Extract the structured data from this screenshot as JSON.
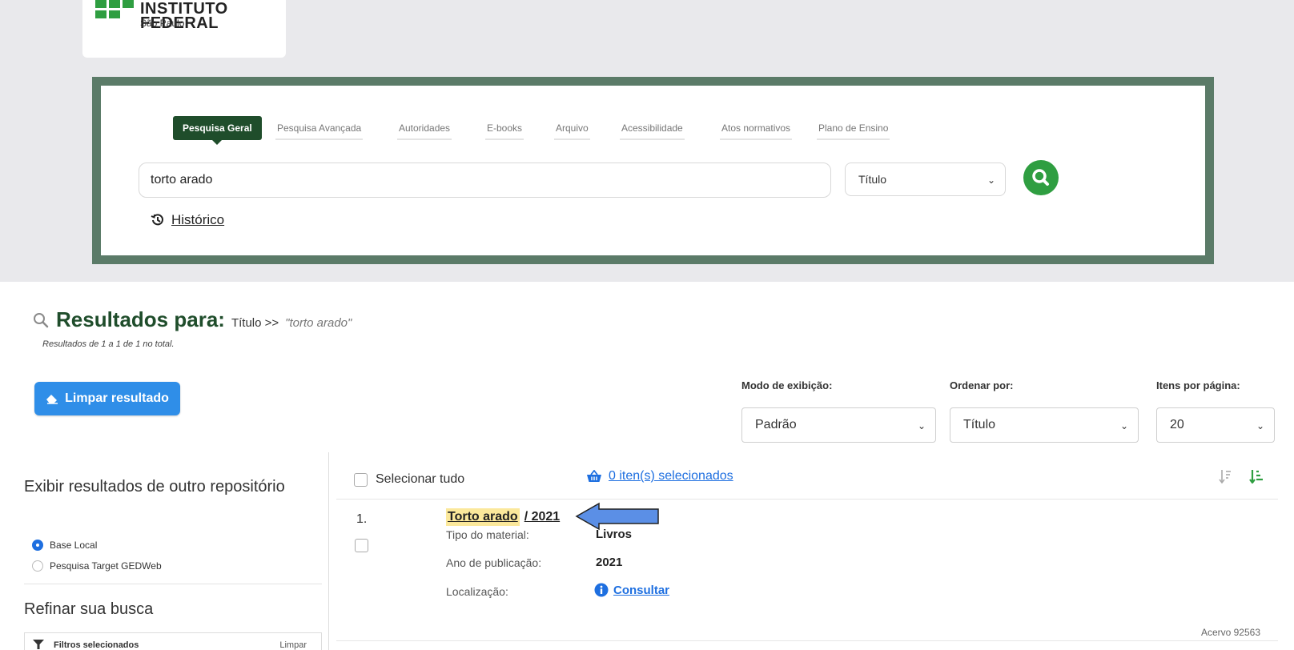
{
  "logo": {
    "name": "INSTITUTO FEDERAL",
    "subtitle": "São Paulo"
  },
  "search": {
    "tabs": [
      {
        "label": "Pesquisa Geral"
      },
      {
        "label": "Pesquisa Avançada"
      },
      {
        "label": "Autoridades"
      },
      {
        "label": "E-books"
      },
      {
        "label": "Arquivo"
      },
      {
        "label": "Acessibilidade"
      },
      {
        "label": "Atos normativos"
      },
      {
        "label": "Plano de Ensino"
      }
    ],
    "query": "torto arado",
    "field": "Título",
    "history_label": "Histórico"
  },
  "results": {
    "title": "Resultados para:",
    "field": "Título >>",
    "query": "\"torto arado\"",
    "count_text": "Resultados de 1 a 1 de 1 no total.",
    "clear_label": "Limpar resultado"
  },
  "controls": {
    "display_label": "Modo de exibição:",
    "display_value": "Padrão",
    "sort_label": "Ordenar por:",
    "sort_value": "Título",
    "per_page_label": "Itens por página:",
    "per_page_value": "20"
  },
  "sidebar": {
    "repo_title": "Exibir resultados de outro repositório",
    "repos": [
      {
        "label": "Base Local",
        "selected": true
      },
      {
        "label": "Pesquisa Target GEDWeb",
        "selected": false
      }
    ],
    "refine_title": "Refinar sua busca",
    "filters_label": "Filtros selecionados",
    "filters_clear": "Limpar"
  },
  "list": {
    "select_all": "Selecionar tudo",
    "selected_count": "0 iten(s) selecionados"
  },
  "item": {
    "number": "1.",
    "title": "Torto arado",
    "year_suffix": "/ 2021",
    "type_label": "Tipo do material:",
    "type_value": "Livros",
    "year_label": "Ano de publicação:",
    "year_value": "2021",
    "location_label": "Localização:",
    "location_link": "Consultar",
    "acervo": "Acervo 92563"
  },
  "colors": {
    "brand_green": "#2f9e41",
    "dark_green": "#1f4d2b",
    "frame_green": "#5b7b68",
    "link_blue": "#1e6fe0",
    "button_blue": "#2f8ee8",
    "highlight": "#fbe89b",
    "annotation_arrow": "#5b8fe6"
  }
}
